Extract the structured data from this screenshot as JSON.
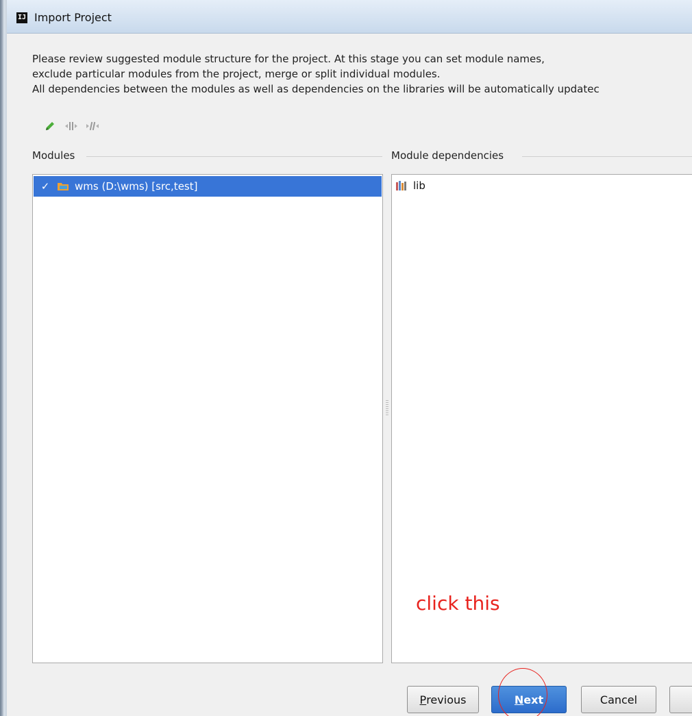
{
  "window": {
    "title": "Import Project",
    "app_icon": "IJ"
  },
  "description": {
    "line1": "Please review suggested module structure for the project. At this stage you can set module names,",
    "line2": "exclude particular modules from the project, merge or split individual modules.",
    "line3": "All dependencies between the modules as well as dependencies on the libraries will be automatically updatec"
  },
  "toolbar": {
    "icons": [
      "pencil-icon",
      "merge-modules-icon",
      "split-module-icon"
    ]
  },
  "modules": {
    "label": "Modules",
    "items": [
      {
        "label": "wms (D:\\wms) [src,test]",
        "checked": true,
        "selected": true
      }
    ]
  },
  "dependencies": {
    "label": "Module dependencies",
    "items": [
      {
        "label": "lib"
      }
    ]
  },
  "annotation": {
    "text": "click this",
    "color": "#e8231e"
  },
  "buttons": {
    "previous": {
      "mnemonic": "P",
      "rest": "revious"
    },
    "next": {
      "mnemonic": "N",
      "rest": "ext"
    },
    "cancel": "Cancel"
  },
  "colors": {
    "selection": "#3875d7",
    "primary_button": "#3c7fd6",
    "annotation_red": "#e8231e"
  }
}
